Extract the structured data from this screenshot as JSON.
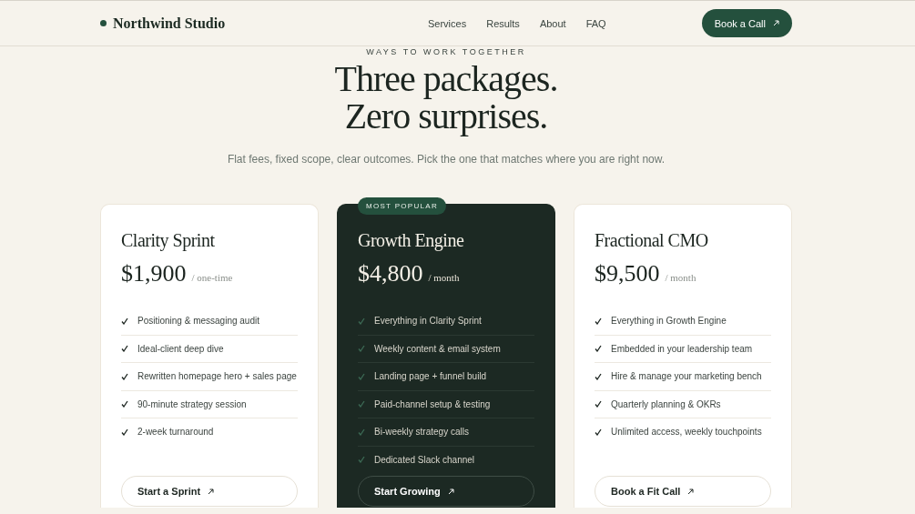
{
  "header": {
    "brand": "Northwind Studio",
    "nav": [
      "Services",
      "Results",
      "About",
      "FAQ"
    ],
    "cta": "Book a Call"
  },
  "hero": {
    "eyebrow": "WAYS TO WORK TOGETHER",
    "title_lines": [
      "Three packages.",
      "Zero surprises."
    ],
    "subtitle": "Flat fees, fixed scope, clear outcomes. Pick the one that matches where you are right now."
  },
  "plans": [
    {
      "name": "Clarity Sprint",
      "price": "$1,900",
      "period": "/ one-time",
      "featured": false,
      "features": [
        "Positioning & messaging audit",
        "Ideal-client deep dive",
        "Rewritten homepage hero + sales page",
        "90-minute strategy session",
        "2-week turnaround"
      ],
      "button": "Start a Sprint"
    },
    {
      "name": "Growth Engine",
      "price": "$4,800",
      "period": "/ month",
      "featured": true,
      "badge": "MOST POPULAR",
      "features": [
        "Everything in Clarity Sprint",
        "Weekly content & email system",
        "Landing page + funnel build",
        "Paid-channel setup & testing",
        "Bi-weekly strategy calls",
        "Dedicated Slack channel"
      ],
      "button": "Start Growing"
    },
    {
      "name": "Fractional CMO",
      "price": "$9,500",
      "period": "/ month",
      "featured": false,
      "features": [
        "Everything in Growth Engine",
        "Embedded in your leadership team",
        "Hire & manage your marketing bench",
        "Quarterly planning & OKRs",
        "Unlimited access, weekly touchpoints"
      ],
      "button": "Book a Fit Call"
    }
  ]
}
